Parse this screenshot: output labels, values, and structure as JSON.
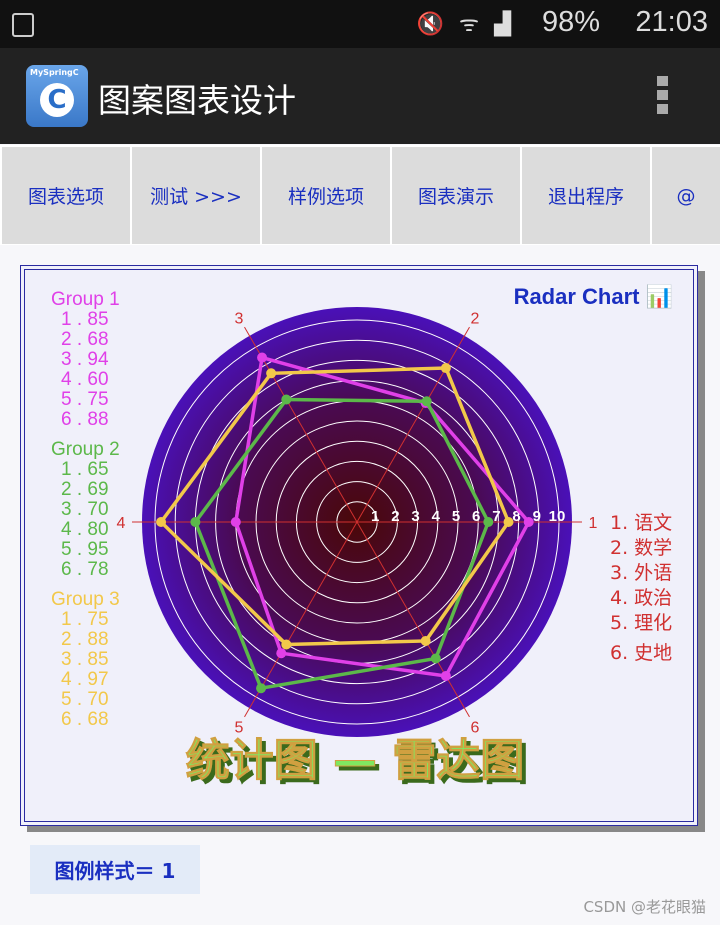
{
  "status_bar": {
    "battery": "98%",
    "time": "21:03",
    "icons": [
      "gallery-icon",
      "mute-icon",
      "wifi-icon",
      "signal-icon",
      "battery-icon"
    ]
  },
  "app_bar": {
    "logo_text": "MySpringC",
    "logo_letter": "C",
    "title": "图案图表设计"
  },
  "toolbar": {
    "buttons": [
      "图表选项",
      "测试  >>>",
      "样例选项",
      "图表演示",
      "退出程序",
      "@"
    ]
  },
  "legend_style_button": "图例样式＝ 1",
  "watermark": "CSDN @老花眼猫",
  "chart_data": {
    "type": "radar",
    "title": "Radar Chart 📊",
    "caption": "统计图 — 雷达图",
    "axes": [
      "1",
      "2",
      "3",
      "4",
      "5",
      "6"
    ],
    "axis_names": [
      "1. 语文",
      "2. 数学",
      "3. 外语",
      "4. 政治",
      "5. 理化",
      "6. 史地"
    ],
    "ring_labels": [
      "1",
      "2",
      "3",
      "4",
      "5",
      "6",
      "7",
      "8",
      "9",
      "10"
    ],
    "range": [
      0,
      100
    ],
    "series": [
      {
        "name": "Group 1",
        "color": "#e040e8",
        "values": [
          85,
          68,
          94,
          60,
          75,
          88
        ],
        "labels": [
          "1 . 85",
          "2 . 68",
          "3 . 94",
          "4 . 60",
          "5 . 75",
          "6 . 88"
        ]
      },
      {
        "name": "Group 2",
        "color": "#5cb84a",
        "values": [
          65,
          69,
          70,
          80,
          95,
          78
        ],
        "labels": [
          "1 . 65",
          "2 . 69",
          "3 . 70",
          "4 . 80",
          "5 . 95",
          "6 . 78"
        ]
      },
      {
        "name": "Group 3",
        "color": "#f2c84a",
        "values": [
          75,
          88,
          85,
          97,
          70,
          68
        ],
        "labels": [
          "1 . 75",
          "2 . 88",
          "3 . 85",
          "4 . 97",
          "5 . 70",
          "6 . 68"
        ]
      }
    ],
    "colors": {
      "axis": "#d03030",
      "ring": "#ffffff",
      "title": "#1a2fc0",
      "caption": "#7fe860",
      "disk_outer": "#4a10b8",
      "disk_center": "#4a0808"
    }
  }
}
